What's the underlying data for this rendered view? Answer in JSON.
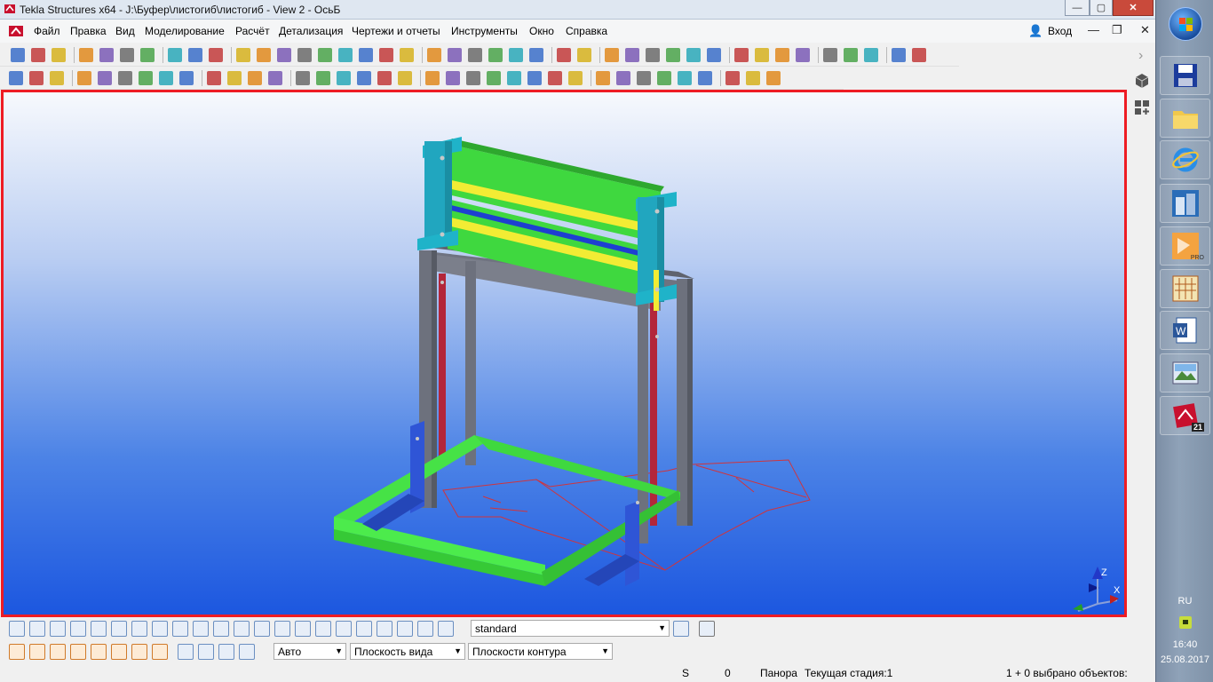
{
  "window": {
    "title": "Tekla Structures x64 - J:\\Буфер\\листогиб\\листогиб  - View 2 - ОсьБ",
    "controls": {
      "minimize": "—",
      "maximize": "▢",
      "close": "✕"
    }
  },
  "menu": {
    "items": [
      "Файл",
      "Правка",
      "Вид",
      "Моделирование",
      "Расчёт",
      "Детализация",
      "Чертежи и отчеты",
      "Инструменты",
      "Окно",
      "Справка"
    ],
    "login_label": "Вход",
    "doc_controls": {
      "minimize": "—",
      "restore": "❐",
      "close": "✕"
    }
  },
  "bottom_toolbar": {
    "view_setting": "standard",
    "snap_mode": "Авто",
    "view_plane": "Плоскость вида",
    "contour_planes": "Плоскости контура"
  },
  "status": {
    "s_label": "S",
    "s_value": "0",
    "mode": "Панора",
    "phase": "Текущая стадия:1",
    "selected": "1 + 0 выбрано объектов:"
  },
  "axis_labels": {
    "z": "Z",
    "x": "X"
  },
  "taskbar": {
    "language": "RU",
    "time": "16:40",
    "date": "25.08.2017",
    "tekla_version_badge": "21",
    "pro_badge": "PRO"
  },
  "colors": {
    "viewport_border": "#ee1c24",
    "frame_grey": "#6f7380",
    "green": "#3fd83f",
    "cyan": "#1fb3c9",
    "yellow": "#f2ec34",
    "red_post": "#b3263a",
    "blue_plate": "#2f55d6",
    "grid_red": "#d0343c"
  }
}
